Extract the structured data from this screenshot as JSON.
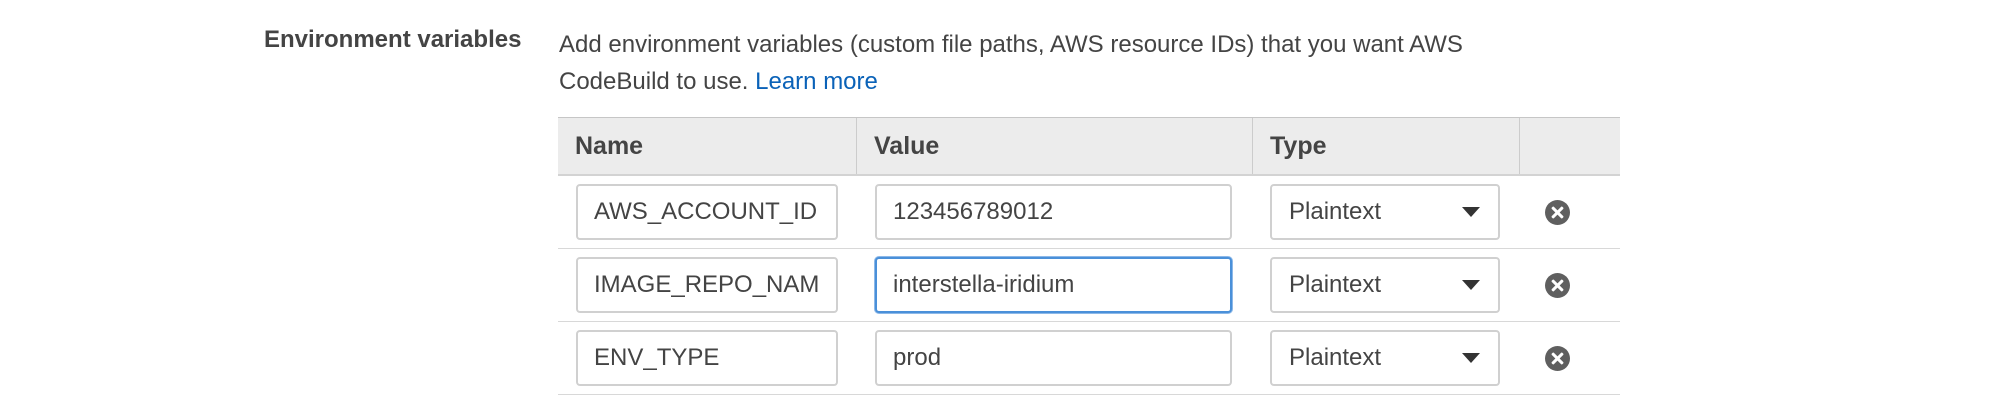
{
  "section": {
    "label": "Environment variables",
    "description": "Add environment variables (custom file paths, AWS resource IDs) that you want AWS CodeBuild to use.",
    "learn_more": "Learn more"
  },
  "table": {
    "headers": {
      "name": "Name",
      "value": "Value",
      "type": "Type"
    },
    "rows": [
      {
        "name": "AWS_ACCOUNT_ID",
        "value": "123456789012",
        "type": "Plaintext",
        "focused": false
      },
      {
        "name": "IMAGE_REPO_NAME",
        "value": "interstella-iridium",
        "type": "Plaintext",
        "focused": true
      },
      {
        "name": "ENV_TYPE",
        "value": "prod",
        "type": "Plaintext",
        "focused": false
      }
    ]
  },
  "icons": {
    "delete": "close-circle-icon",
    "dropdown": "caret-down-icon"
  },
  "colors": {
    "link": "#0a62b8",
    "focus_border": "#4a90d9",
    "header_bg": "#ececec"
  }
}
